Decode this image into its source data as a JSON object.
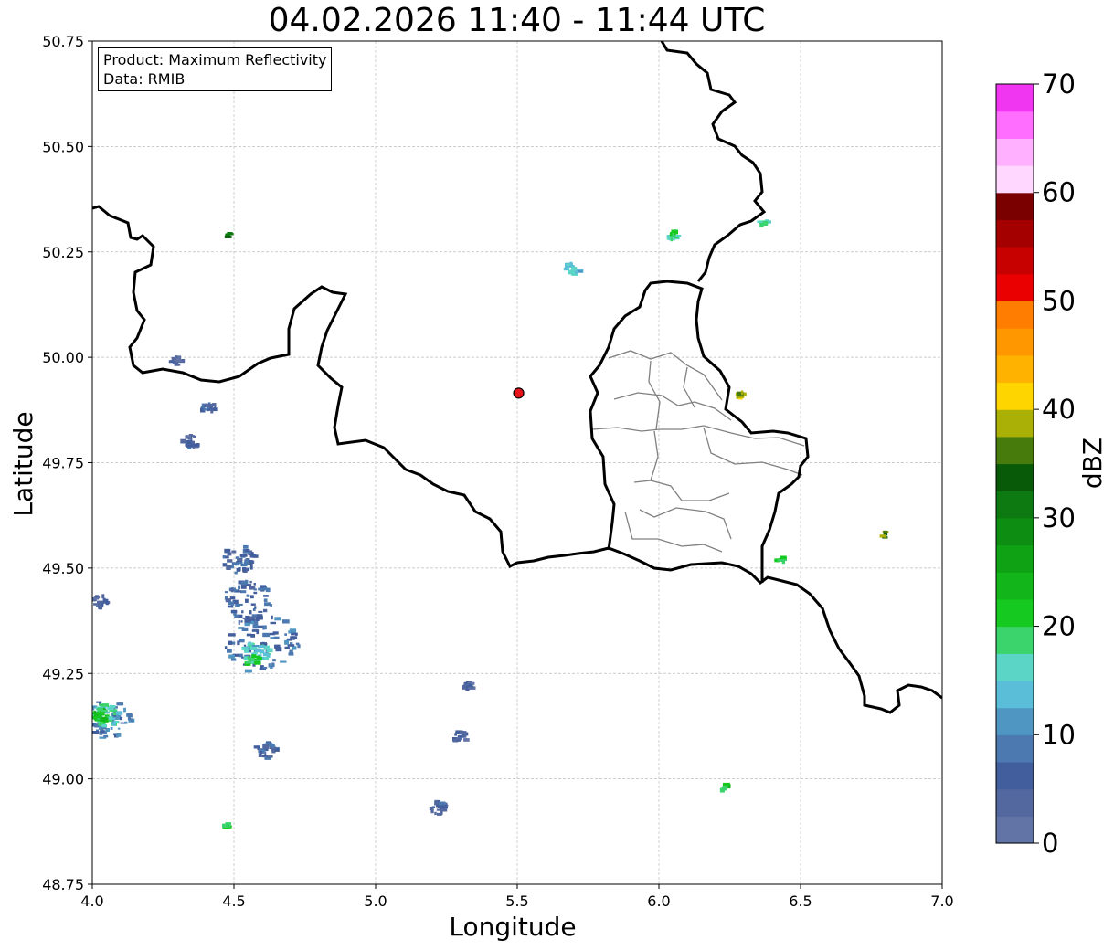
{
  "title": "04.02.2026 11:40 - 11:44 UTC",
  "info": {
    "product_line": "Product: Maximum Reflectivity",
    "data_line": "Data: RMIB"
  },
  "map": {
    "xlabel": "Longitude",
    "ylabel": "Latitude",
    "xlim": [
      4.0,
      7.0
    ],
    "ylim": [
      48.75,
      50.75
    ],
    "xticks": [
      4.0,
      4.5,
      5.0,
      5.5,
      6.0,
      6.5,
      7.0
    ],
    "yticks": [
      48.75,
      49.0,
      49.25,
      49.5,
      49.75,
      50.0,
      50.25,
      50.5,
      50.75
    ],
    "xtick_labels": [
      "4.0",
      "4.5",
      "5.0",
      "5.5",
      "6.0",
      "6.5",
      "7.0"
    ],
    "ytick_labels": [
      "48.75",
      "49.00",
      "49.25",
      "49.50",
      "49.75",
      "50.00",
      "50.25",
      "50.50",
      "50.75"
    ],
    "grid": true,
    "radar_site": [
      5.505,
      49.915
    ],
    "radar_color": "#e8141c"
  },
  "colorbar": {
    "label": "dBZ",
    "min": 0,
    "max": 70,
    "tick_values": [
      0,
      10,
      20,
      30,
      40,
      50,
      60,
      70
    ],
    "tick_labels": [
      "0",
      "10",
      "20",
      "30",
      "40",
      "50",
      "60",
      "70"
    ],
    "colors": [
      "#6273a6",
      "#53689f",
      "#425e9d",
      "#4b79b0",
      "#4f96c2",
      "#5abed8",
      "#5bd6c6",
      "#3bd46c",
      "#15c920",
      "#13b61a",
      "#0fa215",
      "#0d8d12",
      "#0c7a10",
      "#085a09",
      "#477b0b",
      "#abb007",
      "#ffd500",
      "#ffb300",
      "#ff9800",
      "#ff7d00",
      "#ea0000",
      "#c70000",
      "#a50000",
      "#7a0000",
      "#ffd7ff",
      "#ffb0ff",
      "#ff6eff",
      "#f036f0"
    ]
  },
  "chart_data": {
    "type": "heatmap",
    "title": "04.02.2026 11:40 - 11:44 UTC",
    "xlabel": "Longitude",
    "ylabel": "Latitude",
    "xlim": [
      4.0,
      7.0
    ],
    "ylim": [
      48.75,
      50.75
    ],
    "value_label": "dBZ",
    "value_range": [
      0,
      70
    ],
    "echo_cells": [
      {
        "lon": 4.6,
        "lat": 49.32,
        "size": 0.13,
        "dbz": 8
      },
      {
        "lon": 4.55,
        "lat": 49.42,
        "size": 0.09,
        "dbz": 7
      },
      {
        "lon": 4.58,
        "lat": 49.3,
        "size": 0.05,
        "dbz": 15
      },
      {
        "lon": 4.57,
        "lat": 49.28,
        "size": 0.025,
        "dbz": 20
      },
      {
        "lon": 4.52,
        "lat": 49.52,
        "size": 0.06,
        "dbz": 6
      },
      {
        "lon": 4.05,
        "lat": 49.14,
        "size": 0.09,
        "dbz": 9
      },
      {
        "lon": 4.05,
        "lat": 49.15,
        "size": 0.05,
        "dbz": 17
      },
      {
        "lon": 4.03,
        "lat": 49.15,
        "size": 0.03,
        "dbz": 22
      },
      {
        "lon": 4.62,
        "lat": 49.07,
        "size": 0.04,
        "dbz": 6
      },
      {
        "lon": 4.35,
        "lat": 49.8,
        "size": 0.03,
        "dbz": 5
      },
      {
        "lon": 4.41,
        "lat": 49.88,
        "size": 0.025,
        "dbz": 6
      },
      {
        "lon": 4.3,
        "lat": 49.99,
        "size": 0.02,
        "dbz": 5
      },
      {
        "lon": 4.03,
        "lat": 49.42,
        "size": 0.03,
        "dbz": 5
      },
      {
        "lon": 5.22,
        "lat": 48.93,
        "size": 0.03,
        "dbz": 5
      },
      {
        "lon": 5.3,
        "lat": 49.1,
        "size": 0.025,
        "dbz": 5
      },
      {
        "lon": 5.33,
        "lat": 49.22,
        "size": 0.02,
        "dbz": 5
      },
      {
        "lon": 5.7,
        "lat": 50.21,
        "size": 0.03,
        "dbz": 14
      },
      {
        "lon": 6.05,
        "lat": 50.29,
        "size": 0.02,
        "dbz": 18
      },
      {
        "lon": 6.37,
        "lat": 50.32,
        "size": 0.015,
        "dbz": 18
      },
      {
        "lon": 6.29,
        "lat": 49.91,
        "size": 0.015,
        "dbz": 40
      },
      {
        "lon": 6.8,
        "lat": 49.58,
        "size": 0.015,
        "dbz": 35
      },
      {
        "lon": 6.43,
        "lat": 49.52,
        "size": 0.015,
        "dbz": 20
      },
      {
        "lon": 6.23,
        "lat": 48.98,
        "size": 0.015,
        "dbz": 20
      },
      {
        "lon": 4.48,
        "lat": 48.89,
        "size": 0.012,
        "dbz": 20
      },
      {
        "lon": 4.48,
        "lat": 50.29,
        "size": 0.012,
        "dbz": 30
      }
    ]
  }
}
